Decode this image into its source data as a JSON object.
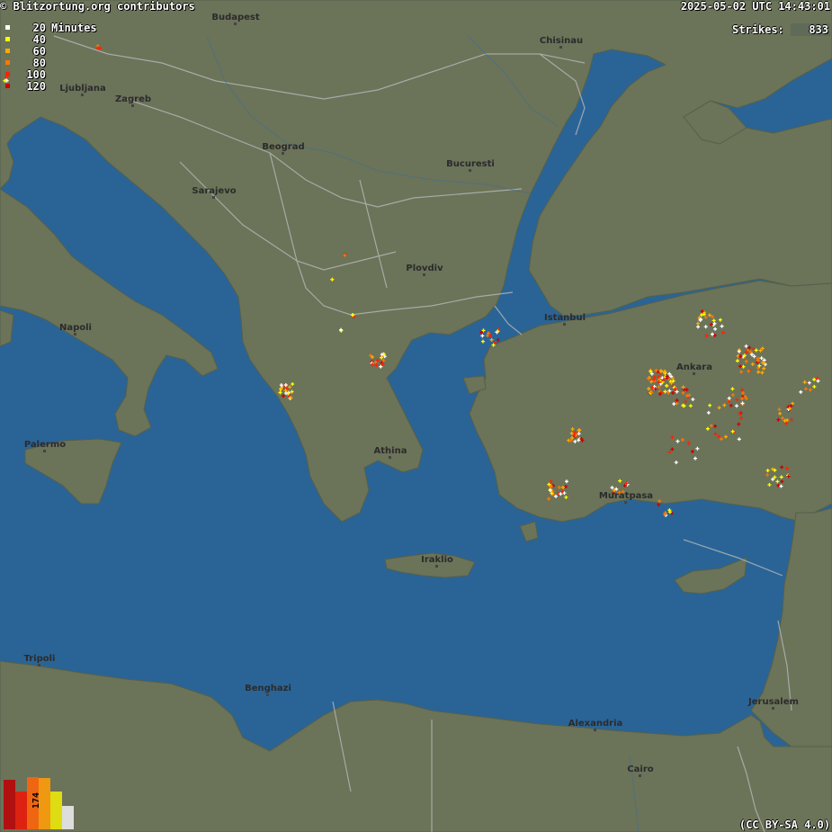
{
  "header": {
    "copyright": "© Blitzortung.org contributors",
    "timestamp": "2025-05-02 UTC 14:43:01",
    "strikes_label": "Strikes:",
    "strikes_value": "833",
    "license": "(CC BY-SA 4.0)"
  },
  "legend": [
    {
      "label": "20",
      "unit": "Minutes",
      "color": "#ffffff"
    },
    {
      "label": "40",
      "unit": "",
      "color": "#ffff00"
    },
    {
      "label": "60",
      "unit": "",
      "color": "#ffaa00"
    },
    {
      "label": "80",
      "unit": "",
      "color": "#ff7700"
    },
    {
      "label": "100",
      "unit": "",
      "color": "#ff2200"
    },
    {
      "label": "120",
      "unit": "",
      "color": "#cc0000"
    }
  ],
  "histogram": {
    "peak_label": "174",
    "colors": [
      "#b01010",
      "#dd2211",
      "#ee6611",
      "#ee9911",
      "#dddd11",
      "#dddddd"
    ],
    "values": [
      0.95,
      0.72,
      1.0,
      0.98,
      0.72,
      0.45
    ]
  },
  "colors": {
    "sea": "#2a6496",
    "land": "#6b7359",
    "border": "#b8b8b8"
  },
  "cities": [
    {
      "name": "Budapest"
    },
    {
      "name": "Chisinau"
    },
    {
      "name": "Ljubljana"
    },
    {
      "name": "Zagreb"
    },
    {
      "name": "Beograd"
    },
    {
      "name": "Bucuresti"
    },
    {
      "name": "Sarajevo"
    },
    {
      "name": "Plovdiv"
    },
    {
      "name": "Istanbul"
    },
    {
      "name": "Napoli"
    },
    {
      "name": "Ankara"
    },
    {
      "name": "Palermo"
    },
    {
      "name": "Athina"
    },
    {
      "name": "Muratpasa"
    },
    {
      "name": "Iraklio"
    },
    {
      "name": "Tripoli"
    },
    {
      "name": "Benghazi"
    },
    {
      "name": "Alexandria"
    },
    {
      "name": "Jerusalem"
    },
    {
      "name": "Cairo"
    }
  ]
}
